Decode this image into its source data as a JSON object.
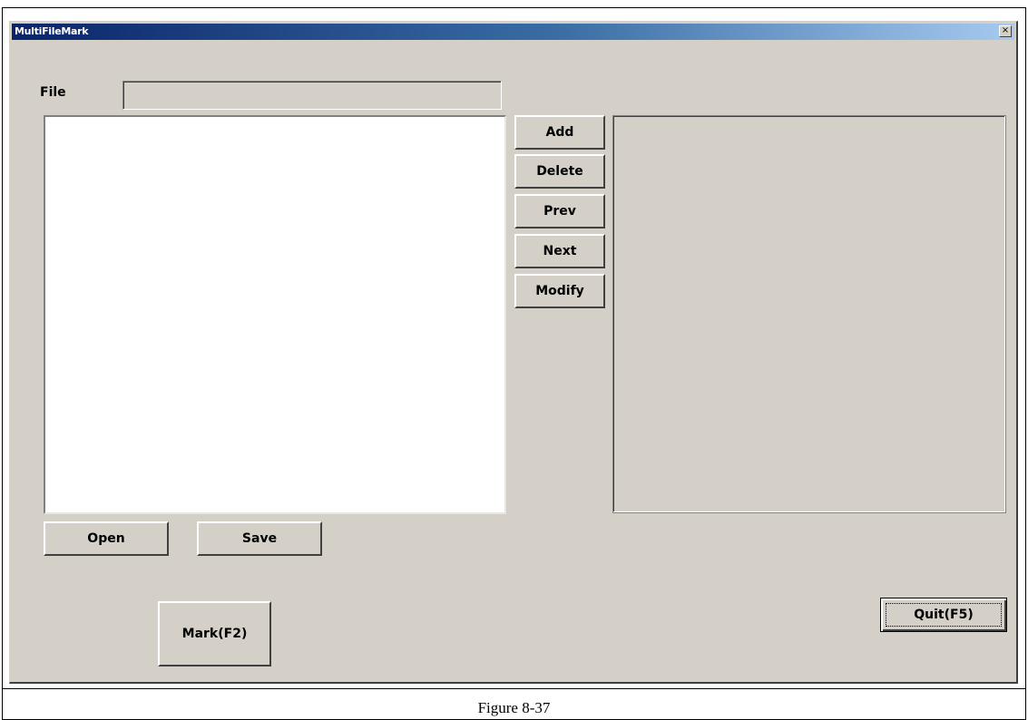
{
  "window": {
    "title": "MultiFileMark",
    "close_glyph": "×"
  },
  "file": {
    "label": "File",
    "value": ""
  },
  "buttons": {
    "add": "Add",
    "delete": "Delete",
    "prev": "Prev",
    "next": "Next",
    "modify": "Modify",
    "open": "Open",
    "save": "Save",
    "mark": "Mark(F2)",
    "quit": "Quit(F5)"
  },
  "listbox": {
    "items": []
  },
  "caption": "Figure 8-37",
  "icons": {
    "close": "close-icon"
  },
  "colors": {
    "dialog_bg": "#d4d0c8",
    "titlebar_start": "#0a246a",
    "titlebar_end": "#a6caf0"
  }
}
